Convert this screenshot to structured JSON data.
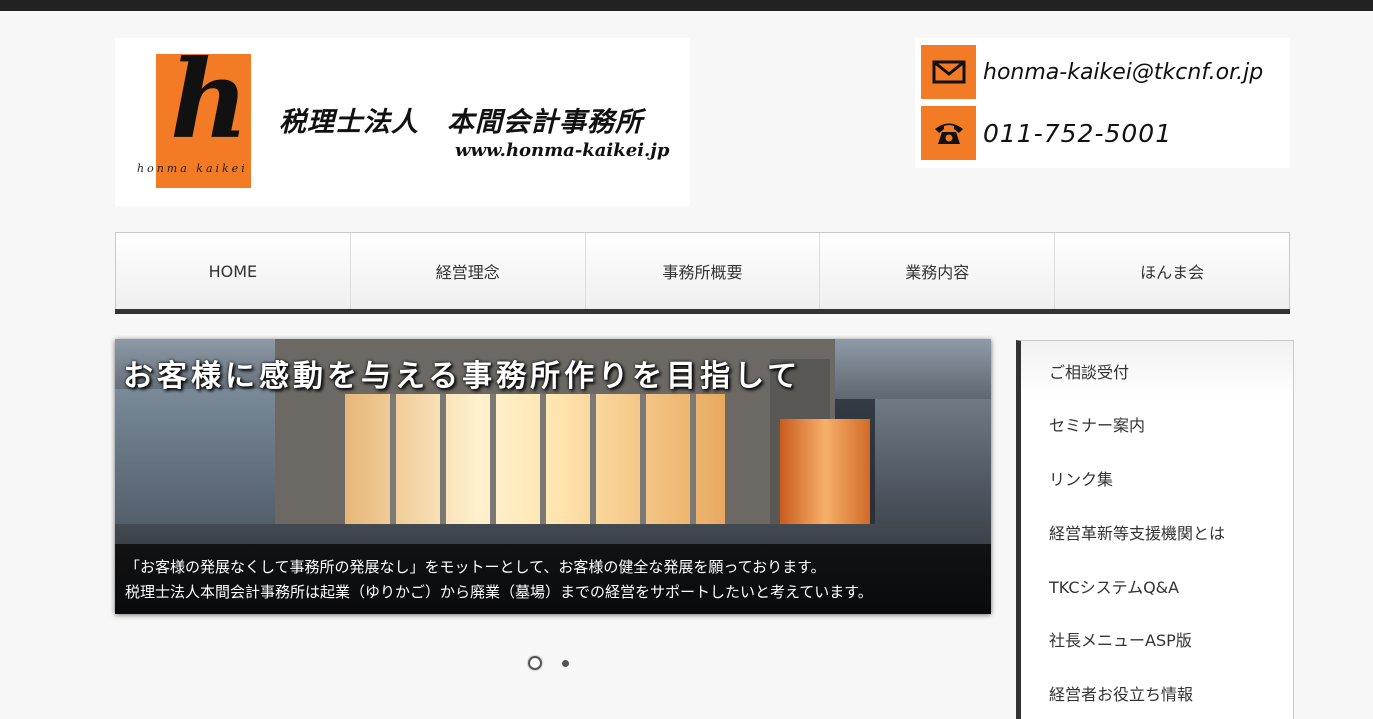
{
  "header": {
    "logo_letter": "h",
    "logo_romaji": "honma kaikei",
    "firm_name": "税理士法人　本間会計事務所",
    "url": "www.honma-kaikei.jp"
  },
  "contact": {
    "email_icon": "envelope-icon",
    "email": "honma-kaikei@tkcnf.or.jp",
    "phone_icon": "telephone-icon",
    "phone": "011-752-5001"
  },
  "nav": {
    "items": [
      {
        "label": "HOME"
      },
      {
        "label": "経営理念"
      },
      {
        "label": "事務所概要"
      },
      {
        "label": "業務内容"
      },
      {
        "label": "ほんま会"
      }
    ]
  },
  "slider": {
    "headline": "お客様に感動を与える事務所作りを目指して",
    "caption_line1": "「お客様の発展なくして事務所の発展なし」をモットーとして、お客様の健全な発展を願っております。",
    "caption_line2": "税理士法人本間会計事務所は起業（ゆりかご）から廃業（墓場）までの経営をサポートしたいと考えています。",
    "active_slide": 1,
    "slide_count": 2
  },
  "sidebar": {
    "items": [
      {
        "label": "ご相談受付"
      },
      {
        "label": "セミナー案内"
      },
      {
        "label": "リンク集"
      },
      {
        "label": "経営革新等支援機関とは"
      },
      {
        "label": "TKCシステムQ&A"
      },
      {
        "label": "社長メニューASP版"
      },
      {
        "label": "経営者お役立ち情報"
      }
    ]
  },
  "colors": {
    "accent": "#f47b25",
    "dark_bar": "#333333",
    "background": "#f7f7f7"
  }
}
